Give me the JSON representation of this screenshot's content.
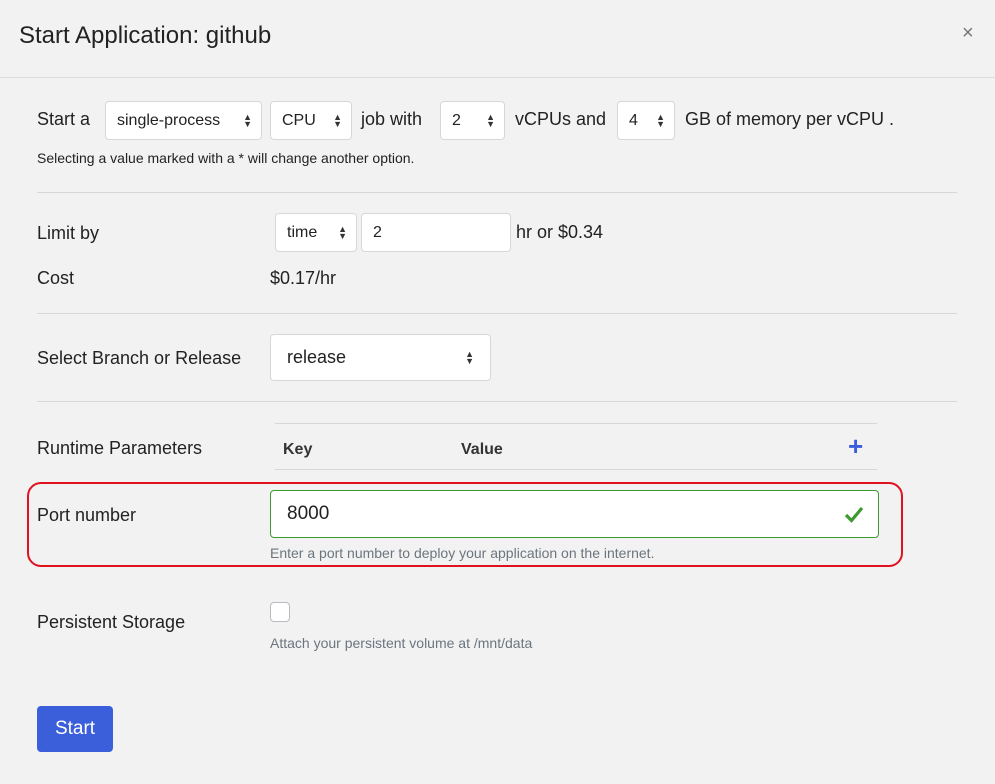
{
  "modal": {
    "title": "Start Application: github",
    "close": "×"
  },
  "job": {
    "prefix": "Start a",
    "process": "single-process",
    "device": "CPU",
    "job_with": "job with",
    "vcpus": "2",
    "vcpus_and": "vCPUs and",
    "memory": "4",
    "memory_suffix": "GB of memory per vCPU .",
    "note": "Selecting a value marked with a * will change another option."
  },
  "limit": {
    "label": "Limit by",
    "type": "time",
    "value": "2",
    "suffix": "hr or $0.34"
  },
  "cost": {
    "label": "Cost",
    "value": "$0.17/hr"
  },
  "branch": {
    "label": "Select Branch or Release",
    "value": "release"
  },
  "runtime": {
    "label": "Runtime Parameters",
    "key_header": "Key",
    "value_header": "Value",
    "add": "+"
  },
  "port": {
    "label": "Port number",
    "value": "8000",
    "help": "Enter a port number to deploy your application on the internet."
  },
  "storage": {
    "label": "Persistent Storage",
    "checked": false,
    "help": "Attach your persistent volume at /mnt/data"
  },
  "start_label": "Start",
  "colors": {
    "accent": "#3b5fdb",
    "valid": "#3c9a2f",
    "highlight": "#e0121f"
  }
}
